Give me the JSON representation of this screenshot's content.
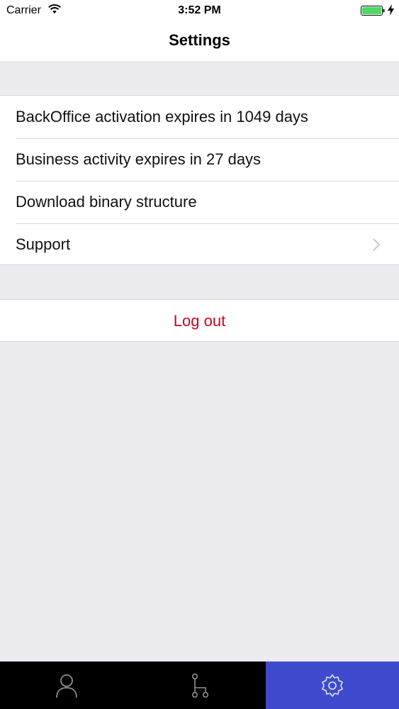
{
  "status_bar": {
    "carrier": "Carrier",
    "time": "3:52 PM",
    "battery_color": "#4cd964"
  },
  "nav": {
    "title": "Settings"
  },
  "settings": {
    "items": [
      {
        "label": "BackOffice activation expires in 1049 days",
        "has_chevron": false
      },
      {
        "label": "Business activity expires in 27 days",
        "has_chevron": false
      },
      {
        "label": "Download binary structure",
        "has_chevron": false
      },
      {
        "label": "Support",
        "has_chevron": true
      }
    ]
  },
  "logout": {
    "label": "Log out",
    "color": "#d0021b"
  },
  "tab_bar": {
    "tabs": [
      {
        "icon": "person-icon",
        "active": false
      },
      {
        "icon": "branch-icon",
        "active": false
      },
      {
        "icon": "gear-icon",
        "active": true
      }
    ],
    "active_color": "#3f4bcf",
    "background": "#000000"
  }
}
